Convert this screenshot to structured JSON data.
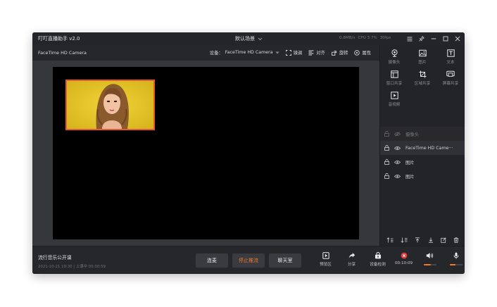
{
  "window": {
    "app_title": "叮叮直播助手 v2.0",
    "scene": "默认场景",
    "stats": {
      "net": "0.8MB/s",
      "cpu": "CPU 3.7%",
      "fps": "30fps"
    }
  },
  "subbar": {
    "camera_name": "FaceTime HD Camera",
    "device_label": "设备：",
    "device_value": "FaceTime HD Camera",
    "tools": [
      "镜调",
      "对齐",
      "旋转",
      "属性"
    ]
  },
  "sources": [
    {
      "label": "摄像头",
      "icon": "camera-icon"
    },
    {
      "label": "图片",
      "icon": "image-icon"
    },
    {
      "label": "文本",
      "icon": "text-icon"
    },
    {
      "label": "窗口共享",
      "icon": "window-share-icon"
    },
    {
      "label": "区域共享",
      "icon": "crop-icon"
    },
    {
      "label": "屏幕共享",
      "icon": "screen-share-icon"
    },
    {
      "label": "音视频",
      "icon": "video-icon"
    }
  ],
  "layers": [
    {
      "name": "摄像头",
      "locked": false,
      "visible": false,
      "selected": false
    },
    {
      "name": "FaceTime HD Came···",
      "locked": true,
      "visible": true,
      "selected": true
    },
    {
      "name": "图片",
      "locked": true,
      "visible": true,
      "selected": false
    },
    {
      "name": "图片",
      "locked": false,
      "visible": true,
      "selected": false
    }
  ],
  "bottom": {
    "room_title": "流行音乐公开课",
    "date": "2021-10-21 19:30",
    "live_status": "上课中 00:30:59",
    "connect_label": "连麦",
    "stop_label": "停止推流",
    "chat_label": "聊天室",
    "tools": [
      {
        "label": "预览区",
        "icon": "preview-icon"
      },
      {
        "label": "分享",
        "icon": "share-icon"
      },
      {
        "label": "设备检测",
        "icon": "device-check-icon"
      },
      {
        "label": "00:10:09",
        "icon": "record-stop-icon"
      }
    ],
    "speaker_level": 0.6,
    "mic_level": 0.45
  },
  "colors": {
    "accent": "#f07a2a",
    "record": "#e2393a",
    "source_border": "#e85a2a"
  }
}
